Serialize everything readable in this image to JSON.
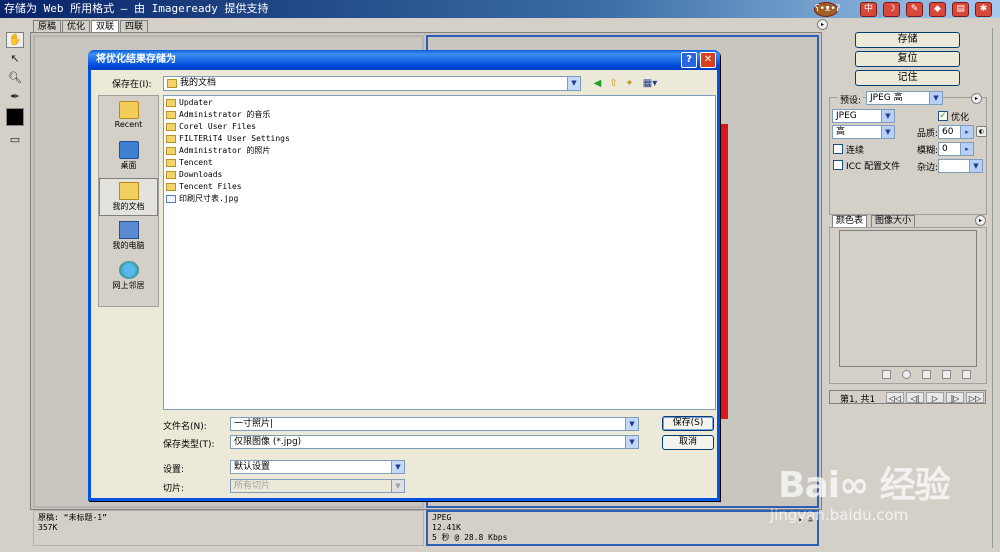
{
  "window": {
    "title": "存储为 Web 所用格式 — 由 Imageready 提供支持",
    "bear_buttons": [
      "中",
      "☽",
      "✎",
      "◆",
      "▤",
      "✱"
    ]
  },
  "tabs": [
    "原稿",
    "优化",
    "双联",
    "四联"
  ],
  "active_tab": "双联",
  "info": {
    "left_line1": "原稿: “未标题-1”",
    "left_line2": "357K",
    "right_line1": "JPEG",
    "right_line2": "12.41K",
    "right_line3": "5 秒 @ 28.8 Kbps",
    "right_menu": "▸ ≡"
  },
  "right_panel": {
    "save_label": "存储",
    "reset_label": "复位",
    "remember_label": "记住",
    "preset_label": "预设:",
    "preset_value": "JPEG 高",
    "format_value": "JPEG",
    "optimize_label": "优化",
    "quality_preset_value": "高",
    "quality_label": "品质:",
    "quality_value": "60",
    "progressive_label": "连续",
    "blur_label": "模糊:",
    "blur_value": "0",
    "icc_label": "ICC 配置文件",
    "matte_label": "杂边:",
    "color_tab": "颜色表",
    "size_tab": "图像大小",
    "frame_label": "第1, 共1",
    "frame_buttons": [
      "◁◁",
      "◁|",
      "▷",
      "|▷",
      "▷▷"
    ]
  },
  "dialog": {
    "title": "将优化结果存储为",
    "lookin_label": "保存在(I):",
    "lookin_value": "我的文档",
    "places": [
      "Recent",
      "桌面",
      "我的文档",
      "我的电脑",
      "网上邻居"
    ],
    "files": [
      {
        "name": "Updater",
        "type": "folder"
      },
      {
        "name": "Administrator 的音乐",
        "type": "folder"
      },
      {
        "name": "Corel User Files",
        "type": "folder"
      },
      {
        "name": "FILTERiT4 User Settings",
        "type": "folder"
      },
      {
        "name": "Administrator 的照片",
        "type": "folder"
      },
      {
        "name": "Tencent",
        "type": "folder"
      },
      {
        "name": "Downloads",
        "type": "folder"
      },
      {
        "name": "Tencent Files",
        "type": "folder"
      },
      {
        "name": "印刷尺寸表.jpg",
        "type": "file"
      }
    ],
    "filename_label": "文件名(N):",
    "filename_value": "一寸照片|",
    "filetype_label": "保存类型(T):",
    "filetype_value": "仅限图像 (*.jpg)",
    "settings_label": "设置:",
    "settings_value": "默认设置",
    "slices_label": "切片:",
    "slices_value": "所有切片",
    "save_button": "保存(S)",
    "cancel_button": "取消",
    "help_glyph": "?",
    "close_glyph": "✕"
  },
  "watermark": {
    "text": "Bai∞ 经验",
    "sub": "jingyan.baidu.com"
  },
  "colors": {
    "accent": "#0054e3",
    "pane_active": "#2c5fb5",
    "photo_red": "#d81818"
  }
}
